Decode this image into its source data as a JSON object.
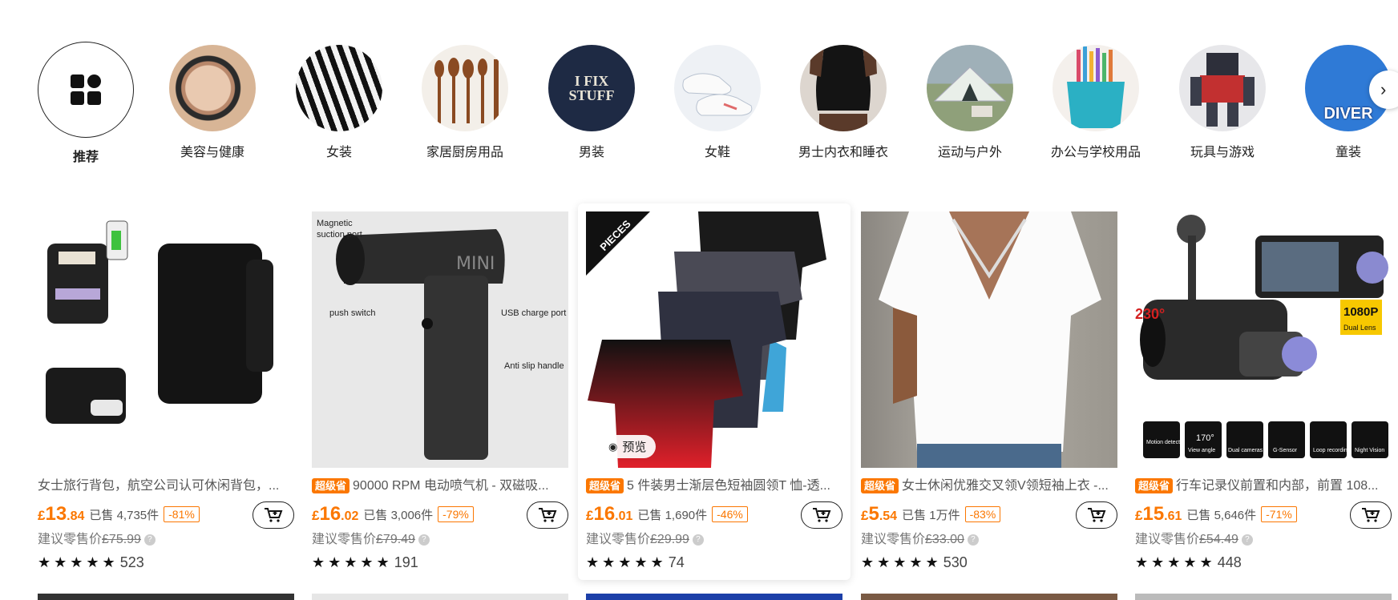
{
  "categories": [
    {
      "label": "推荐",
      "icon": "grid-icon",
      "active": true
    },
    {
      "label": "美容与健康"
    },
    {
      "label": "女装"
    },
    {
      "label": "家居厨房用品"
    },
    {
      "label": "男装"
    },
    {
      "label": "女鞋"
    },
    {
      "label": "男士内衣和睡衣"
    },
    {
      "label": "运动与户外"
    },
    {
      "label": "办公与学校用品"
    },
    {
      "label": "玩具与游戏"
    },
    {
      "label": "童装"
    }
  ],
  "products": [
    {
      "title": "女士旅行背包，航空公司认可休闲背包，...",
      "badge": "",
      "currency": "£",
      "price_int": "13",
      "price_dec": ".84",
      "sold": "已售 4,735件",
      "discount": "-81%",
      "rrp_label": "建议零售价",
      "rrp": "£75.99",
      "rating": "523"
    },
    {
      "title": "90000 RPM 电动喷气机 - 双磁吸...",
      "badge": "超级省",
      "currency": "£",
      "price_int": "16",
      "price_dec": ".02",
      "sold": "已售 3,006件",
      "discount": "-79%",
      "rrp_label": "建议零售价",
      "rrp": "£79.49",
      "rating": "191",
      "image_labels": {
        "a": "Magnetic",
        "b": "suction port",
        "c": "push switch",
        "d": "USB charge port",
        "e": "Anti slip handle",
        "brand": "MINI"
      }
    },
    {
      "title": "5 件装男士渐层色短袖圆领T 恤-透...",
      "badge": "超级省",
      "currency": "£",
      "price_int": "16",
      "price_dec": ".01",
      "sold": "已售 1,690件",
      "discount": "-46%",
      "rrp_label": "建议零售价",
      "rrp": "£29.99",
      "rating": "74",
      "preview_label": "预览",
      "image_labels": {
        "ribbon": "PIECES"
      }
    },
    {
      "title": "女士休闲优雅交叉领V领短袖上衣 -...",
      "badge": "超级省",
      "currency": "£",
      "price_int": "5",
      "price_dec": ".54",
      "sold": "已售 1万件",
      "discount": "-83%",
      "rrp_label": "建议零售价",
      "rrp": "£33.00",
      "rating": "530"
    },
    {
      "title": "行车记录仪前置和内部，前置 108...",
      "badge": "超级省",
      "currency": "£",
      "price_int": "15",
      "price_dec": ".61",
      "sold": "已售 5,646件",
      "discount": "-71%",
      "rrp_label": "建议零售价",
      "rrp": "£54.49",
      "rating": "448",
      "image_labels": {
        "angle": "230°",
        "res": "1080P",
        "lens": "Dual Lens",
        "f1": "Motion detections",
        "f2": "170°",
        "f2b": "View angle",
        "f3": "Dual cameras",
        "f4": "G-Sensor",
        "f5": "Loop recording",
        "f6": "Night Vision"
      }
    }
  ],
  "category_images": {
    "tshirt": "I FIX STUFF",
    "kid": "DIVER"
  },
  "colors": {
    "accent": "#fb7701",
    "text": "#222222"
  }
}
